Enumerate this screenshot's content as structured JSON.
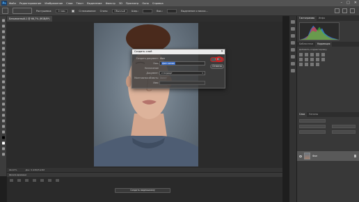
{
  "menu": {
    "logo": "Ps",
    "items": [
      "Файл",
      "Редактирование",
      "Изображение",
      "Слои",
      "Текст",
      "Выделение",
      "Фильтр",
      "3D",
      "Просмотр",
      "Окно",
      "Справка"
    ],
    "window_controls": [
      "–",
      "□",
      "✕"
    ]
  },
  "options": {
    "feather_label": "Растушевка:",
    "feather_value": "0 пикс",
    "antialias_label": "Сглаживание",
    "style_label": "Стиль:",
    "style_value": "Обычный",
    "width_label": "Шир.:",
    "height_label": "Выс.:",
    "refine_label": "Выделение и маска..."
  },
  "document_tab": "Безымянный-1 @ 66,7% (RGB/8*)",
  "status": {
    "zoom": "66,67%",
    "doc_info": "Док: 5,93M/5,93M"
  },
  "timeline": {
    "title": "Шкала времени",
    "create_button": "Создать видеошкалу"
  },
  "panels": {
    "histogram_tabs": [
      "Гистограмма",
      "Инфо"
    ],
    "properties_tabs": [
      "Библиотеки",
      "Коррекция"
    ],
    "properties_hint": "Добавить корректировку",
    "layers_tabs": [
      "Слои",
      "Каналы"
    ],
    "layer_name": "Фон"
  },
  "dialog": {
    "title": "Создать слой",
    "close": "✕",
    "rows": [
      {
        "label": "Создать документ:",
        "value": "Фон"
      },
      {
        "label": "Имя:",
        "input_selected": "фон копия"
      },
      {
        "label": "Назначение",
        "value": ""
      },
      {
        "label": "Документ:",
        "select": "стандарт"
      },
      {
        "label": "Монтажная область:",
        "value": "Холст"
      },
      {
        "label": "Имя:",
        "value": ""
      }
    ],
    "ok": "OK",
    "cancel": "Отмена"
  },
  "colors": {
    "accent_selection": "#2f66c8",
    "highlight_ring": "#d62020",
    "workspace": "#2b2b2b"
  }
}
